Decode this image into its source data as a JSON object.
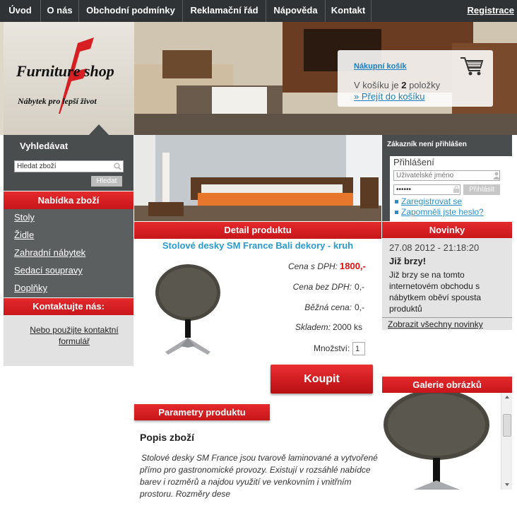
{
  "nav": {
    "items": [
      "Úvod",
      "O nás",
      "Obchodní podmínky",
      "Reklamační řád",
      "Nápověda",
      "Kontakt"
    ],
    "register": "Registrace"
  },
  "logo": {
    "brand": "Furniture shop",
    "slogan": "Nábytek pro lepší život"
  },
  "basket": {
    "title": "Nákupní košík",
    "text_prefix": "V košíku je",
    "count": "2",
    "text_suffix": "položky",
    "link": "» Přejít do košíku"
  },
  "search": {
    "title": "Vyhledávat",
    "value": "Hledat zboží",
    "button": "Hledat"
  },
  "categories": {
    "title": "Nabídka zboží",
    "items": [
      "Stoly",
      "Židle",
      "Zahradní nábytek",
      "Sedací soupravy",
      "Doplňky"
    ]
  },
  "contact": {
    "title": "Kontaktujte nás:",
    "link": "Nebo použijte kontaktní formulář"
  },
  "login": {
    "status": "Zákazník není přihlášen",
    "title": "Přihlášení",
    "username_placeholder": "Uživatelské jméno",
    "password_value": "••••••",
    "button": "Přihlásit",
    "register_link": "Zaregistrovat se",
    "forgot_link": "Zapomněli jste heslo?"
  },
  "detail": {
    "header": "Detail produktu",
    "product_title": "Stolové desky SM France Bali dekory - kruh",
    "price_vat_label": "Cena s DPH:",
    "price_vat": "1800,-",
    "price_novat_label": "Cena bez DPH:",
    "price_novat": "0,-",
    "regular_label": "Běžná cena:",
    "regular": "0,-",
    "stock_label": "Skladem:",
    "stock": "2000 ks",
    "qty_label": "Množství:",
    "qty": "1",
    "buy": "Koupit"
  },
  "params": {
    "header": "Parametry produktu",
    "desc_title": "Popis zboží",
    "desc": "Stolové desky SM France jsou tvarově laminované a vytvořené přímo pro gastronomické provozy. Existují v rozsáhlé nabídce barev i rozměrů a najdou využití ve venkovním i vnitřním prostoru. Rozměry dese"
  },
  "news": {
    "header": "Novinky",
    "date": "27.08 2012 - 21:18:20",
    "title": "Již brzy!",
    "text": "Již brzy se na tomto internetovém obchodu s nábytkem oběví spousta produktů",
    "all_link": "Zobrazit všechny novinky"
  },
  "gallery": {
    "header": "Galerie obrázků"
  },
  "colors": {
    "red": "#d71e22",
    "dark": "#2f3335",
    "link_blue": "#1a7fc0",
    "price_red": "#e01010"
  }
}
